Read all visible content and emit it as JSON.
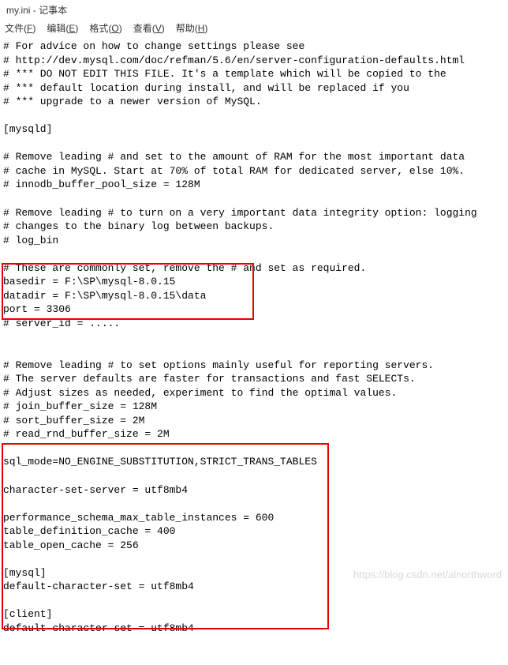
{
  "titlebar": {
    "text": "my.ini - 记事本"
  },
  "menu": {
    "file": "文件(F)",
    "edit": "编辑(E)",
    "format": "格式(O)",
    "view": "查看(V)",
    "help": "帮助(H)"
  },
  "lines": {
    "l01": "# For advice on how to change settings please see",
    "l02": "# http://dev.mysql.com/doc/refman/5.6/en/server-configuration-defaults.html",
    "l03": "# *** DO NOT EDIT THIS FILE. It's a template which will be copied to the",
    "l04": "# *** default location during install, and will be replaced if you",
    "l05": "# *** upgrade to a newer version of MySQL.",
    "l06": "",
    "l07": "[mysqld]",
    "l08": "",
    "l09": "# Remove leading # and set to the amount of RAM for the most important data",
    "l10": "# cache in MySQL. Start at 70% of total RAM for dedicated server, else 10%.",
    "l11": "# innodb_buffer_pool_size = 128M",
    "l12": "",
    "l13": "# Remove leading # to turn on a very important data integrity option: logging",
    "l14": "# changes to the binary log between backups.",
    "l15": "# log_bin",
    "l16": "",
    "l17": "# These are commonly set, remove the # and set as required.",
    "l18": "basedir = F:\\SP\\mysql-8.0.15",
    "l19": "datadir = F:\\SP\\mysql-8.0.15\\data",
    "l20": "port = 3306",
    "l21": "# server_id = .....",
    "l22": "",
    "l23": "",
    "l24": "# Remove leading # to set options mainly useful for reporting servers.",
    "l25": "# The server defaults are faster for transactions and fast SELECTs.",
    "l26": "# Adjust sizes as needed, experiment to find the optimal values.",
    "l27": "# join_buffer_size = 128M",
    "l28": "# sort_buffer_size = 2M",
    "l29": "# read_rnd_buffer_size = 2M",
    "l30": "",
    "l31": "sql_mode=NO_ENGINE_SUBSTITUTION,STRICT_TRANS_TABLES",
    "l32": "",
    "l33": "character-set-server = utf8mb4",
    "l34": "",
    "l35": "performance_schema_max_table_instances = 600",
    "l36": "table_definition_cache = 400",
    "l37": "table_open_cache = 256",
    "l38": "",
    "l39": "[mysql]",
    "l40": "default-character-set = utf8mb4",
    "l41": "",
    "l42": "[client]",
    "l43": "default-character-set = utf8mb4"
  },
  "watermark": "https://blog.csdn.net/alnorthword"
}
